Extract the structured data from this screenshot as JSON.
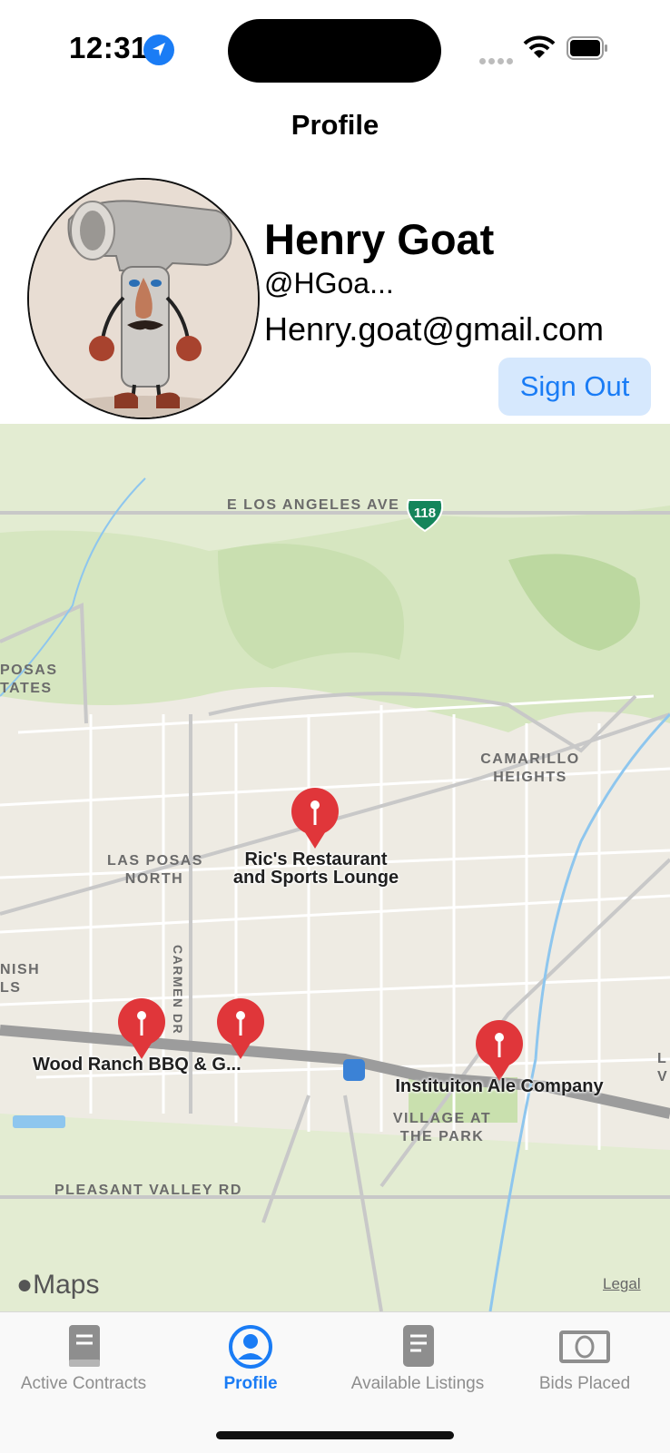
{
  "status_bar": {
    "time": "12:31"
  },
  "nav": {
    "title": "Profile"
  },
  "profile": {
    "name": "Henry Goat",
    "handle": "@HGoa...",
    "email": "Henry.goat@gmail.com",
    "sign_out_label": "Sign Out"
  },
  "map": {
    "roads": {
      "los_angeles_ave": "E LOS ANGELES AVE",
      "highway_shield": "118",
      "carmen_dr": "CARMEN DR",
      "pleasant_valley": "PLEASANT VALLEY RD"
    },
    "areas": {
      "posas_estates_1": "POSAS",
      "posas_estates_2": "TATES",
      "camarillo_1": "CAMARILLO",
      "camarillo_2": "HEIGHTS",
      "las_posas_1": "LAS POSAS",
      "las_posas_2": "NORTH",
      "spanish_hills_1": "NISH",
      "spanish_hills_2": "LS",
      "village_1": "VILLAGE AT",
      "village_2": "THE PARK",
      "edge_1": "L",
      "edge_2": "V"
    },
    "pins": {
      "rics_1": "Ric's Restaurant",
      "rics_2": "and Sports Lounge",
      "wood_ranch": "Wood Ranch BBQ & G...",
      "institution": "Instituiton Ale Company"
    },
    "attribution": "Maps",
    "legal": "Legal"
  },
  "tabs": [
    {
      "label": "Active Contracts",
      "icon": "book-icon"
    },
    {
      "label": "Profile",
      "icon": "person-circle-icon"
    },
    {
      "label": "Available Listings",
      "icon": "document-icon"
    },
    {
      "label": "Bids Placed",
      "icon": "banknote-icon"
    }
  ],
  "colors": {
    "accent": "#1a7cf5",
    "pin": "#e0363a",
    "button_bg": "#d6e8fd"
  }
}
